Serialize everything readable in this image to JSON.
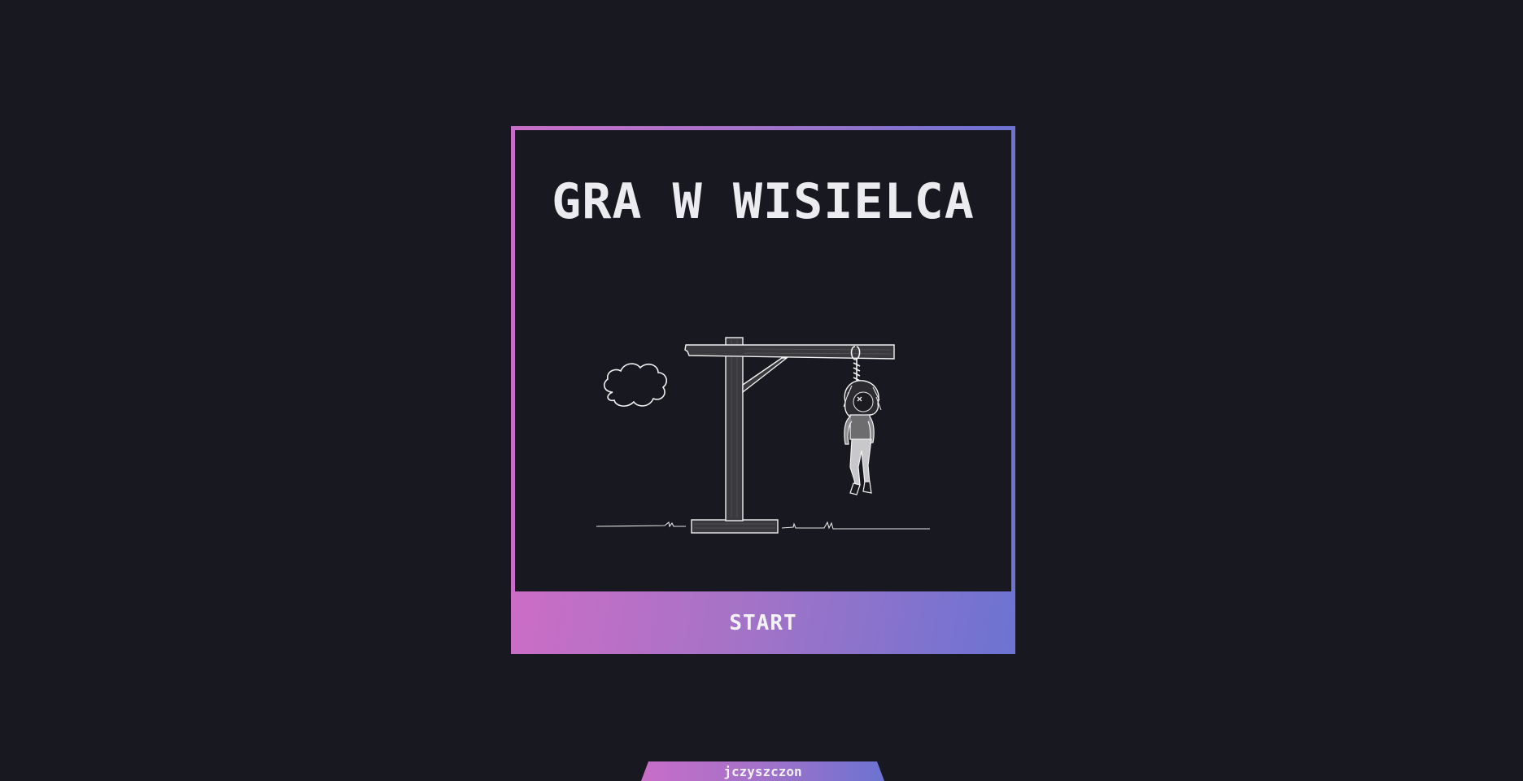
{
  "game": {
    "title": "GRA W WISIELCA",
    "start_label": "START"
  },
  "footer": {
    "author": "jczyszczon"
  },
  "colors": {
    "background": "#171820",
    "gradient_start": "#c86dc7",
    "gradient_end": "#6b73d1",
    "text": "#ececf0"
  },
  "icons": {
    "illustration": "hangman-gallows-icon",
    "cloud": "cloud-icon"
  }
}
